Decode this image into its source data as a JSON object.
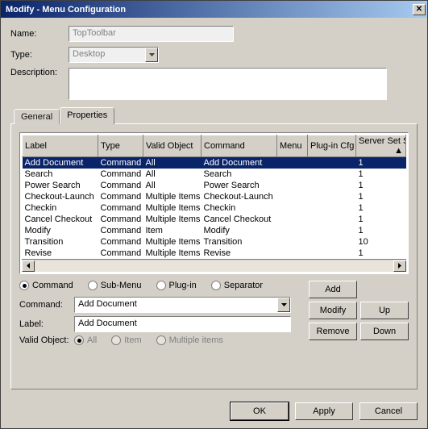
{
  "title": "Modify - Menu Configuration",
  "labels": {
    "name": "Name:",
    "type": "Type:",
    "description": "Description:",
    "commandLbl": "Command:",
    "labelLbl": "Label:",
    "validObjectLbl": "Valid Object:"
  },
  "fields": {
    "name": "TopToolbar",
    "type": "Desktop",
    "description": "",
    "commandSelect": "Add Document",
    "labelInput": "Add Document"
  },
  "tabs": {
    "general": "General",
    "properties": "Properties"
  },
  "columns": {
    "label": "Label",
    "type": "Type",
    "validObject": "Valid Object",
    "command": "Command",
    "menu": "Menu",
    "pluginCfg": "Plug-in Cfg",
    "serverSet": "Server Set Si"
  },
  "rows": [
    {
      "label": "Add Document",
      "type": "Command",
      "valid": "All",
      "cmd": "Add Document",
      "menu": "",
      "plugin": "",
      "srv": "1"
    },
    {
      "label": "Search",
      "type": "Command",
      "valid": "All",
      "cmd": "Search",
      "menu": "",
      "plugin": "",
      "srv": "1"
    },
    {
      "label": "Power Search",
      "type": "Command",
      "valid": "All",
      "cmd": "Power Search",
      "menu": "",
      "plugin": "",
      "srv": "1"
    },
    {
      "label": "Checkout-Launch",
      "type": "Command",
      "valid": "Multiple Items",
      "cmd": "Checkout-Launch",
      "menu": "",
      "plugin": "",
      "srv": "1"
    },
    {
      "label": "Checkin",
      "type": "Command",
      "valid": "Multiple Items",
      "cmd": "Checkin",
      "menu": "",
      "plugin": "",
      "srv": "1"
    },
    {
      "label": "Cancel Checkout",
      "type": "Command",
      "valid": "Multiple Items",
      "cmd": "Cancel Checkout",
      "menu": "",
      "plugin": "",
      "srv": "1"
    },
    {
      "label": "Modify",
      "type": "Command",
      "valid": "Item",
      "cmd": "Modify",
      "menu": "",
      "plugin": "",
      "srv": "1"
    },
    {
      "label": "Transition",
      "type": "Command",
      "valid": "Multiple Items",
      "cmd": "Transition",
      "menu": "",
      "plugin": "",
      "srv": "10"
    },
    {
      "label": "Revise",
      "type": "Command",
      "valid": "Multiple Items",
      "cmd": "Revise",
      "menu": "",
      "plugin": "",
      "srv": "1"
    }
  ],
  "radios": {
    "command": "Command",
    "submenu": "Sub-Menu",
    "plugin": "Plug-in",
    "separator": "Separator",
    "all": "All",
    "item": "Item",
    "multiple": "Multiple items"
  },
  "buttons": {
    "add": "Add",
    "modify": "Modify",
    "remove": "Remove",
    "up": "Up",
    "down": "Down",
    "ok": "OK",
    "apply": "Apply",
    "cancel": "Cancel"
  }
}
